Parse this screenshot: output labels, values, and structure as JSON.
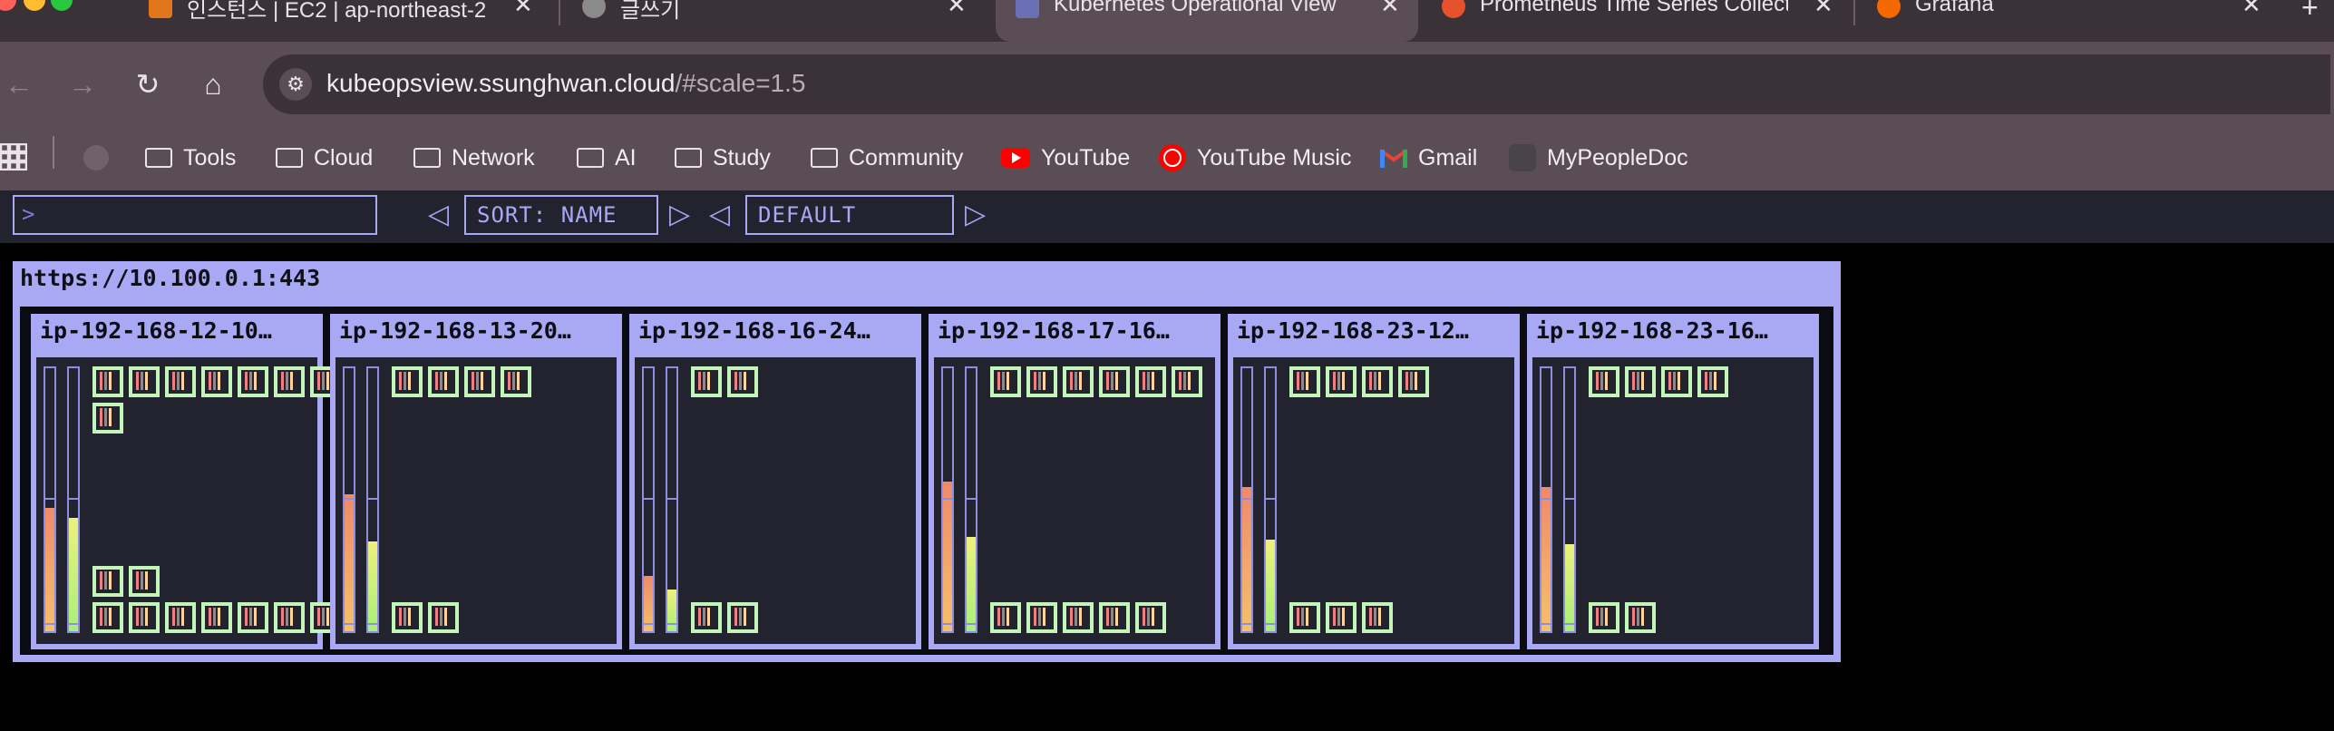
{
  "browser": {
    "tabs": [
      {
        "title": "인스턴스 | EC2 | ap-northeast-2",
        "icon": "aws-ec2-icon",
        "active": false
      },
      {
        "title": "글쓰기",
        "icon": "globe-icon",
        "active": false
      },
      {
        "title": "Kubernetes Operational View",
        "icon": "kube-ops-view-icon",
        "active": true
      },
      {
        "title": "Prometheus Time Series Collection",
        "icon": "prometheus-icon",
        "active": false
      },
      {
        "title": "Grafana",
        "icon": "grafana-icon",
        "active": false
      }
    ],
    "url_host": "kubeopsview.ssunghwan.cloud",
    "url_fragment": "/#scale=1.5",
    "bookmarks": [
      {
        "label": "Tools",
        "icon": "folder-icon"
      },
      {
        "label": "Cloud",
        "icon": "folder-icon"
      },
      {
        "label": "Network",
        "icon": "folder-icon"
      },
      {
        "label": "AI",
        "icon": "folder-icon"
      },
      {
        "label": "Study",
        "icon": "folder-icon"
      },
      {
        "label": "Community",
        "icon": "folder-icon"
      },
      {
        "label": "YouTube",
        "icon": "youtube-icon"
      },
      {
        "label": "YouTube Music",
        "icon": "youtube-music-icon"
      },
      {
        "label": "Gmail",
        "icon": "gmail-icon"
      },
      {
        "label": "MyPeopleDoc",
        "icon": "mypeopledoc-icon"
      }
    ]
  },
  "app": {
    "filter_placeholder": ">",
    "sort_label": "SORT: NAME",
    "theme_label": "DEFAULT",
    "colors": {
      "accent": "#a8a8f5",
      "pod": "#c3f5b9",
      "panel": "#23232f"
    },
    "cluster": {
      "url": "https://10.100.0.1:443",
      "nodes": [
        {
          "name": "ip-192-168-12-10…",
          "cpu": 0.47,
          "mem": 0.43,
          "top_pods": 7,
          "extra_top_pods": 1,
          "mid_pods": 2,
          "bottom_pods": 7
        },
        {
          "name": "ip-192-168-13-20…",
          "cpu": 0.52,
          "mem": 0.34,
          "top_pods": 4,
          "extra_top_pods": 0,
          "mid_pods": 0,
          "bottom_pods": 2
        },
        {
          "name": "ip-192-168-16-24…",
          "cpu": 0.21,
          "mem": 0.16,
          "top_pods": 2,
          "extra_top_pods": 0,
          "mid_pods": 0,
          "bottom_pods": 2
        },
        {
          "name": "ip-192-168-17-16…",
          "cpu": 0.57,
          "mem": 0.36,
          "top_pods": 6,
          "extra_top_pods": 0,
          "mid_pods": 0,
          "bottom_pods": 5
        },
        {
          "name": "ip-192-168-23-12…",
          "cpu": 0.55,
          "mem": 0.35,
          "top_pods": 4,
          "extra_top_pods": 0,
          "mid_pods": 0,
          "bottom_pods": 3
        },
        {
          "name": "ip-192-168-23-16…",
          "cpu": 0.55,
          "mem": 0.33,
          "top_pods": 4,
          "extra_top_pods": 0,
          "mid_pods": 0,
          "bottom_pods": 2
        }
      ]
    }
  }
}
